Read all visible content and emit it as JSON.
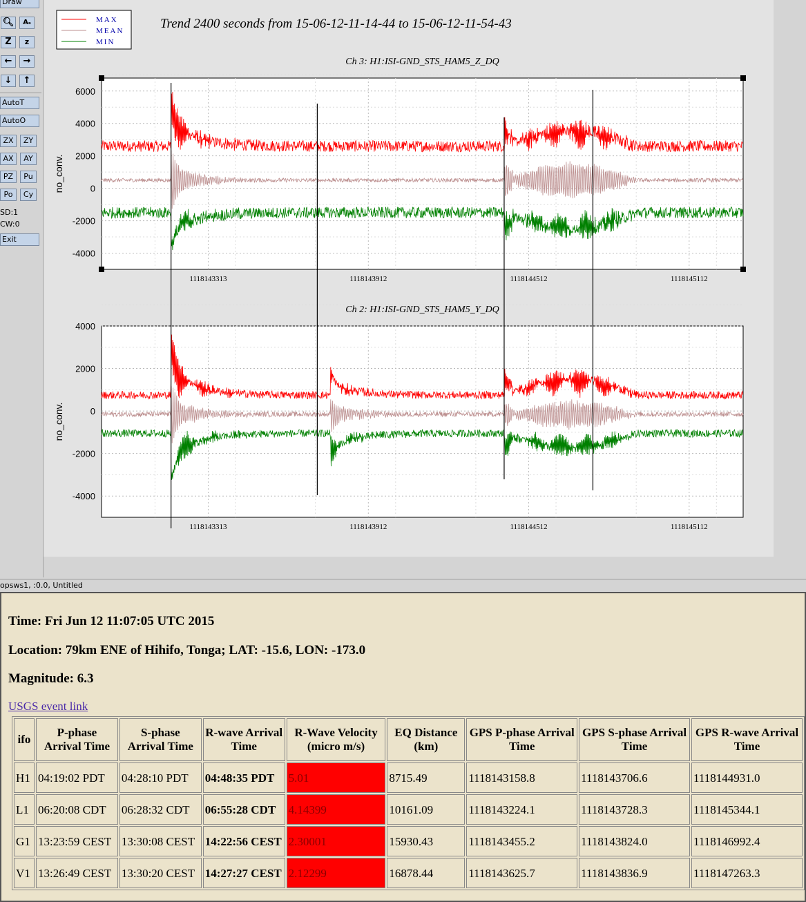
{
  "toolbar": {
    "draw": "Draw",
    "autoT": "AutoT",
    "autoO": "AutoO",
    "zx": "ZX",
    "zy": "ZY",
    "ax": "AX",
    "ay": "AY",
    "pz": "PZ",
    "pu": "Pu",
    "po": "Po",
    "cy": "Cy",
    "sd": "SD:1",
    "cw": "CW:0",
    "exit": "Exit"
  },
  "legend": {
    "max": "MAX",
    "mean": "MEAN",
    "min": "MIN"
  },
  "trend_title": "Trend 2400 seconds from 15-06-12-11-14-44 to 15-06-12-11-54-43",
  "status_bar": "opsws1, :0.0, Untitled",
  "colors": {
    "max": "#ff0000",
    "mean": "#bc8f8f",
    "min": "#008000",
    "velocity_bg": "#ff0000",
    "panel_bg": "#ebe3cb"
  },
  "chart_data": [
    {
      "type": "line",
      "title": "Ch 3: H1:ISI-GND_STS_HAM5_Z_DQ",
      "ylabel": "no_conv.",
      "xlabel": "",
      "xlim": [
        1118142914,
        1118145314
      ],
      "ylim": [
        -5000,
        6800
      ],
      "yticks": [
        -4000,
        -2000,
        0,
        2000,
        4000,
        6000
      ],
      "xticks": [
        1118143313,
        1118143912,
        1118144512,
        1118145112
      ],
      "grid": true,
      "series": [
        {
          "name": "MAX",
          "baseline": 2600,
          "noise": 350
        },
        {
          "name": "MEAN",
          "baseline": 500,
          "noise": 120
        },
        {
          "name": "MIN",
          "baseline": -1500,
          "noise": 350
        }
      ],
      "events": [
        {
          "t": 1118143174,
          "peak_max": 6500,
          "peak_min": -4500
        },
        {
          "t": 1118144421,
          "peak_max": 4300,
          "peak_min": -3300
        }
      ]
    },
    {
      "type": "line",
      "title": "Ch 2: H1:ISI-GND_STS_HAM5_Y_DQ",
      "ylabel": "no_conv.",
      "xlabel": "",
      "xlim": [
        1118142914,
        1118145314
      ],
      "ylim": [
        -5000,
        4000
      ],
      "yticks": [
        -4000,
        -2000,
        0,
        2000,
        4000
      ],
      "xticks": [
        1118143313,
        1118143912,
        1118144512,
        1118145112
      ],
      "grid": true,
      "series": [
        {
          "name": "MAX",
          "baseline": 750,
          "noise": 180
        },
        {
          "name": "MEAN",
          "baseline": -150,
          "noise": 120
        },
        {
          "name": "MIN",
          "baseline": -1050,
          "noise": 180
        }
      ],
      "events": [
        {
          "t": 1118143174,
          "peak_max": 4000,
          "peak_min": -4200
        },
        {
          "t": 1118143770,
          "peak_max": 2200,
          "peak_min": -2800
        },
        {
          "t": 1118144421,
          "peak_max": 2100,
          "peak_min": -2300
        }
      ]
    }
  ],
  "event_markers": [
    1118143174,
    1118143721,
    1118144420,
    1118144752
  ],
  "eq_info": {
    "time": "Time: Fri Jun 12 11:07:05 UTC 2015",
    "location": "Location: 79km ENE of Hihifo, Tonga; LAT: -15.6, LON: -173.0",
    "magnitude": "Magnitude: 6.3",
    "usgs_link": "USGS event link"
  },
  "table": {
    "headers": [
      "ifo",
      "P-phase Arrival Time",
      "S-phase Arrival Time",
      "R-wave Arrival Time",
      "R-Wave Velocity (micro m/s)",
      "EQ Distance (km)",
      "GPS P-phase Arrival Time",
      "GPS S-phase Arrival Time",
      "GPS R-wave Arrival Time"
    ],
    "rows": [
      [
        "H1",
        "04:19:02 PDT",
        "04:28:10 PDT",
        "04:48:35 PDT",
        "5.01",
        "8715.49",
        "1118143158.8",
        "1118143706.6",
        "1118144931.0"
      ],
      [
        "L1",
        "06:20:08 CDT",
        "06:28:32 CDT",
        "06:55:28 CDT",
        "4.14399",
        "10161.09",
        "1118143224.1",
        "1118143728.3",
        "1118145344.1"
      ],
      [
        "G1",
        "13:23:59 CEST",
        "13:30:08 CEST",
        "14:22:56 CEST",
        "2.30001",
        "15930.43",
        "1118143455.2",
        "1118143824.0",
        "1118146992.4"
      ],
      [
        "V1",
        "13:26:49 CEST",
        "13:30:20 CEST",
        "14:27:27 CEST",
        "2.12299",
        "16878.44",
        "1118143625.7",
        "1118143836.9",
        "1118147263.3"
      ]
    ]
  }
}
